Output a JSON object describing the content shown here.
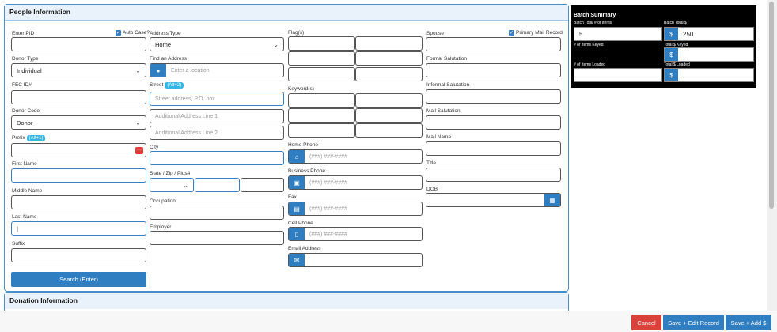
{
  "people_panel": {
    "title": "People Information",
    "enter_pid_label": "Enter PID",
    "auto_case_label": "Auto Case?",
    "donor_type_label": "Donor Type",
    "donor_type_value": "Individual",
    "fec_id_label": "FEC ID#",
    "donor_code_label": "Donor Code",
    "donor_code_value": "Donor",
    "prefix_label": "Prefix",
    "prefix_hint": "(Alt+1)",
    "first_name_label": "First Name",
    "middle_name_label": "Middle Name",
    "last_name_label": "Last Name",
    "last_name_value": "|",
    "suffix_label": "Suffix",
    "search_button": "Search (Enter)",
    "address_type_label": "Address Type",
    "address_type_value": "Home",
    "find_address_label": "Find an Address",
    "find_address_placeholder": "Enter a location",
    "street_label": "Street",
    "street_hint": "(Alt+2)",
    "street_placeholder": "Street address, P.O. box",
    "address1_placeholder": "Additional Address Line 1",
    "address2_placeholder": "Additional Address Line 2",
    "city_label": "City",
    "state_zip_label": "State / Zip / Plus4",
    "occupation_label": "Occupation",
    "employer_label": "Employer",
    "flags_label": "Flag(s)",
    "keywords_label": "Keyword(s)",
    "home_phone_label": "Home Phone",
    "business_phone_label": "Business Phone",
    "fax_label": "Fax",
    "cell_phone_label": "Cell Phone",
    "email_label": "Email Address",
    "phone_placeholder": "(###) ###-####",
    "spouse_label": "Spouse",
    "primary_mail_label": "Primary Mail Record",
    "formal_salutation_label": "Formal Salutation",
    "informal_salutation_label": "Informal Salutation",
    "mail_salutation_label": "Mail Salutation",
    "mail_name_label": "Mail Name",
    "title_label": "Title",
    "dob_label": "DOB"
  },
  "donation_panel": {
    "title": "Donation Information"
  },
  "batch_summary": {
    "title": "Batch Summary",
    "total_items_label": "Batch Total # of Items",
    "total_items_value": "5",
    "total_dollars_label": "Batch Total $",
    "total_dollars_value": "250",
    "items_keyed_label": "# of Items Keyed",
    "dollars_keyed_label": "Total $ Keyed",
    "items_loaded_label": "# of Items Loaded",
    "dollars_loaded_label": "Total $ Loaded",
    "currency_symbol": "$"
  },
  "actions": {
    "cancel": "Cancel",
    "save_edit": "Save + Edit Record",
    "save_add": "Save + Add $"
  },
  "icons": {
    "check": "✓",
    "chevron": "⌄",
    "location": "●",
    "home": "⌂",
    "business": "▣",
    "fax": "▤",
    "cell": "▯",
    "email": "✉",
    "calendar": "▦",
    "dots": "⋯"
  },
  "colors": {
    "primary": "#2f7ec2",
    "danger": "#d9413a",
    "hint": "#33b5e5"
  }
}
